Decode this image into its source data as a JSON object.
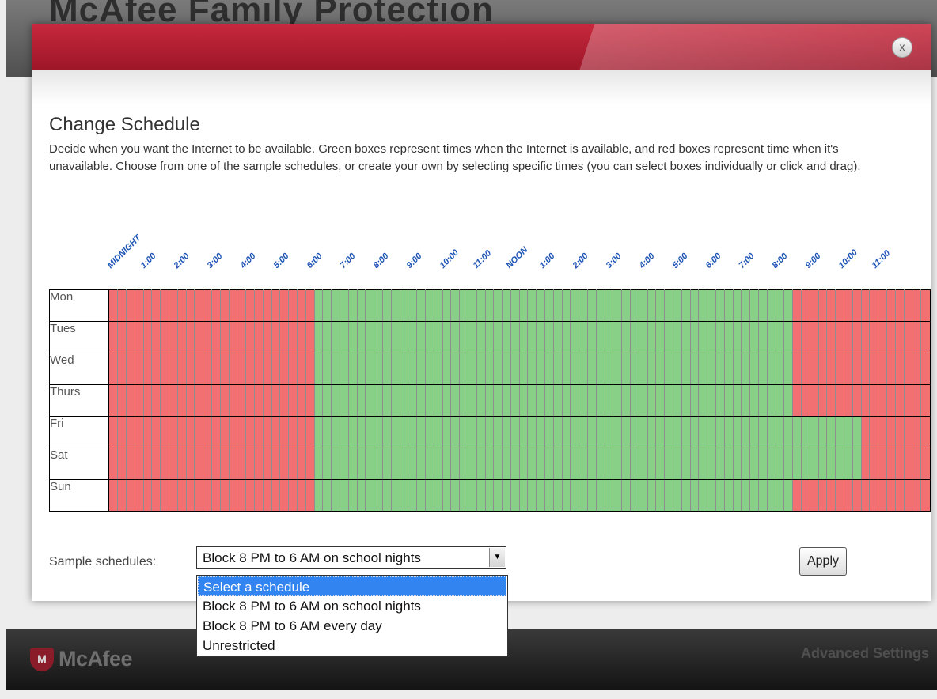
{
  "app": {
    "title": "McAfee Family Protection",
    "footer_logo_text": "McAfee",
    "footer_logo_glyph": "M",
    "advanced_settings": "Advanced Settings"
  },
  "dialog": {
    "close_glyph": "x",
    "title": "Change Schedule",
    "description": "Decide when you want the Internet to be available. Green boxes represent times when the Internet is available, and red boxes represent time when it's unavailable. Choose from one of the sample schedules, or create your own by selecting specific times (you can select boxes individually or click and drag)."
  },
  "time_labels": [
    "MIDNIGHT",
    "1:00",
    "2:00",
    "3:00",
    "4:00",
    "5:00",
    "6:00",
    "7:00",
    "8:00",
    "9:00",
    "10:00",
    "11:00",
    "NOON",
    "1:00",
    "2:00",
    "3:00",
    "4:00",
    "5:00",
    "6:00",
    "7:00",
    "8:00",
    "9:00",
    "10:00",
    "11:00"
  ],
  "days": [
    {
      "label": "Mon",
      "available_from": 6,
      "available_to": 20
    },
    {
      "label": "Tues",
      "available_from": 6,
      "available_to": 20
    },
    {
      "label": "Wed",
      "available_from": 6,
      "available_to": 20
    },
    {
      "label": "Thurs",
      "available_from": 6,
      "available_to": 20
    },
    {
      "label": "Fri",
      "available_from": 6,
      "available_to": 22
    },
    {
      "label": "Sat",
      "available_from": 6,
      "available_to": 22
    },
    {
      "label": "Sun",
      "available_from": 6,
      "available_to": 20
    }
  ],
  "colors": {
    "available": "#88d088",
    "unavailable": "#f26f72",
    "header": "#b31e32",
    "label_blue": "#1d54b5"
  },
  "controls": {
    "sample_label": "Sample schedules:",
    "selected_value": "Block 8 PM to 6 AM on school nights",
    "apply_label": "Apply",
    "options": [
      "Select a schedule",
      "Block 8 PM to 6 AM on school nights",
      "Block 8 PM to 6 AM every day",
      "Unrestricted"
    ],
    "highlighted_index": 0
  }
}
